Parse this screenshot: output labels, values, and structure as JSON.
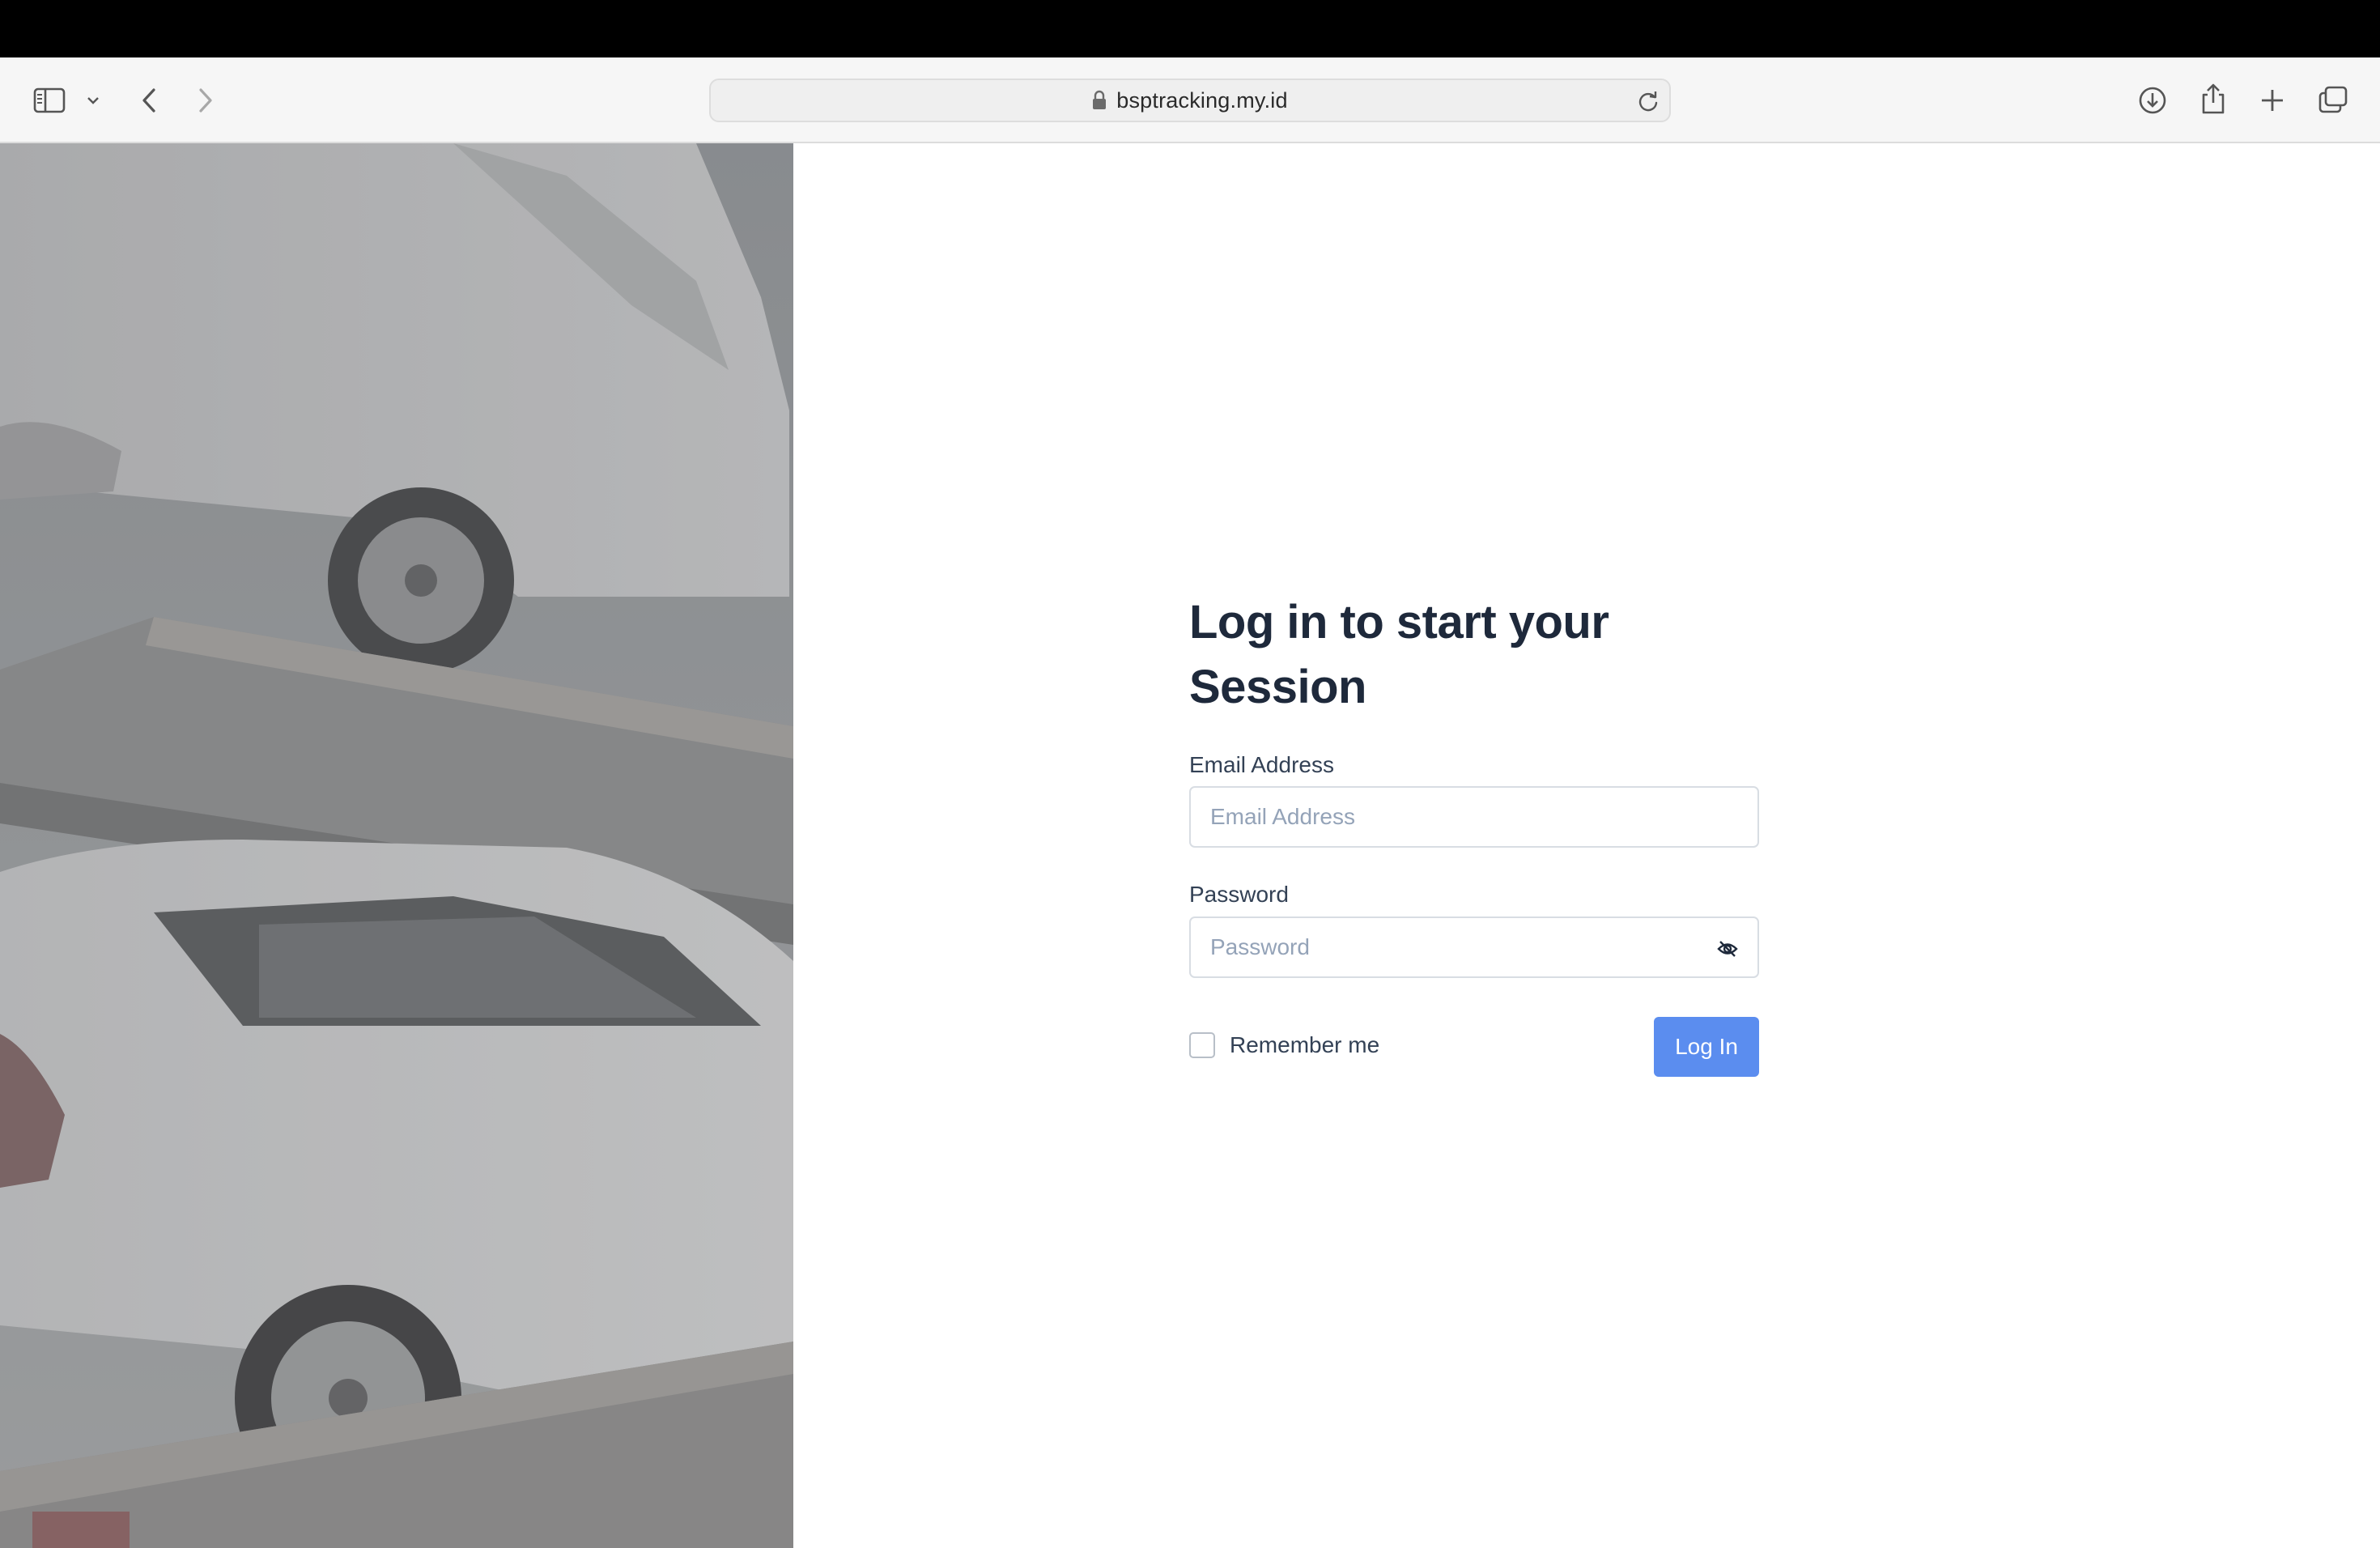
{
  "browser": {
    "url": "bsptracking.my.id",
    "icons": {
      "sidebar": "sidebar-icon",
      "chevron": "chevron-down-icon",
      "back": "back-arrow-icon",
      "forward": "forward-arrow-icon",
      "lock": "lock-icon",
      "reload": "reload-icon",
      "download": "download-icon",
      "share": "share-icon",
      "new_tab": "plus-icon",
      "tabs": "tab-overview-icon"
    }
  },
  "login": {
    "heading": "Log in to start your Session",
    "email_label": "Email Address",
    "email_placeholder": "Email Address",
    "password_label": "Password",
    "password_placeholder": "Password",
    "remember_label": "Remember me",
    "remember_checked": false,
    "submit_label": "Log In"
  },
  "colors": {
    "primary_button": "#5b8def",
    "heading": "#1e293b",
    "label": "#334155",
    "placeholder": "#94a3b8"
  }
}
